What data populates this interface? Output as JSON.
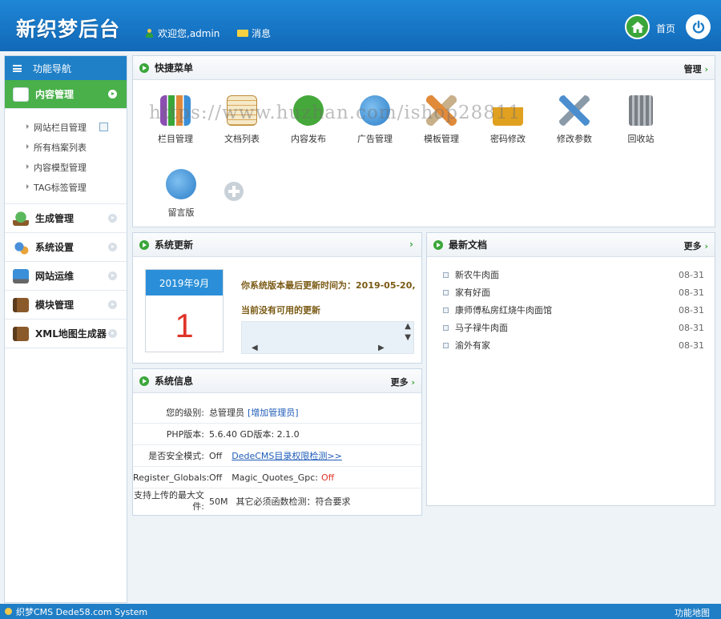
{
  "header": {
    "logo": "新织梦后台",
    "welcome": "欢迎您,admin",
    "message": "消息",
    "home": "首页"
  },
  "sidebar": {
    "title": "功能导航",
    "groups": [
      {
        "label": "内容管理",
        "icon": "pencil-paper-icon",
        "active": true
      },
      {
        "label": "生成管理",
        "icon": "tree-icon"
      },
      {
        "label": "系统设置",
        "icon": "gears-icon"
      },
      {
        "label": "网站运维",
        "icon": "monitor-icon"
      },
      {
        "label": "模块管理",
        "icon": "book-icon"
      },
      {
        "label": "XML地图生成器",
        "icon": "book-icon"
      }
    ],
    "subitems": [
      "网站栏目管理",
      "所有档案列表",
      "内容模型管理",
      "TAG标签管理"
    ]
  },
  "quick_menu": {
    "title": "快捷菜单",
    "manage": "管理",
    "items": [
      {
        "label": "栏目管理",
        "icon": "books-icon",
        "color": "#8a4fb0"
      },
      {
        "label": "文档列表",
        "icon": "notepad-icon",
        "color": "#d8a85a"
      },
      {
        "label": "内容发布",
        "icon": "green-add-icon",
        "color": "#45a83a"
      },
      {
        "label": "广告管理",
        "icon": "globe-icon",
        "color": "#3b8fd8"
      },
      {
        "label": "模板管理",
        "icon": "ruler-pencil-icon",
        "color": "#e08a3a"
      },
      {
        "label": "密码修改",
        "icon": "lock-icon",
        "color": "#e0a020"
      },
      {
        "label": "修改参数",
        "icon": "tools-icon",
        "color": "#4a8ed0"
      },
      {
        "label": "回收站",
        "icon": "trash-icon",
        "color": "#7a7f85"
      },
      {
        "label": "留言版",
        "icon": "globe-icon",
        "color": "#3b8fd8"
      }
    ],
    "watermark": "https://www.huzhan.com/ishop28811"
  },
  "update": {
    "title": "系统更新",
    "month": "2019年9月",
    "day": "1",
    "last_update": "你系统版本最后更新时间为：2019-05-20,",
    "status": "当前没有可用的更新"
  },
  "info": {
    "title": "系统信息",
    "more": "更多",
    "rows": [
      {
        "label": "您的级别:",
        "value": "总管理员",
        "link": "[增加管理员]"
      },
      {
        "label": "PHP版本:",
        "value": "5.6.40  GD版本: 2.1.0"
      },
      {
        "label": "是否安全模式:",
        "value": "Off",
        "link": "DedeCMS目录权限检测>>"
      },
      {
        "label": "Register_Globals:",
        "value": "Off",
        "extra": "Magic_Quotes_Gpc:",
        "extra_value": "Off"
      },
      {
        "label": "支持上传的最大文件:",
        "value": "50M",
        "extra": "其它必须函数检测：符合要求"
      }
    ]
  },
  "docs": {
    "title": "最新文档",
    "more": "更多",
    "items": [
      {
        "title": "新农牛肉面",
        "date": "08-31"
      },
      {
        "title": "家有好面",
        "date": "08-31"
      },
      {
        "title": "康师傅私房红烧牛肉面馆",
        "date": "08-31"
      },
      {
        "title": "马子禄牛肉面",
        "date": "08-31"
      },
      {
        "title": "渝外有家",
        "date": "08-31"
      }
    ]
  },
  "footer": {
    "left": "织梦CMS  Dede58.com System",
    "right": "功能地图"
  },
  "colors": {
    "header": "#1f86d6",
    "active_nav": "#49b04a",
    "accent_green": "#3aa63a",
    "red": "#e0342a"
  }
}
